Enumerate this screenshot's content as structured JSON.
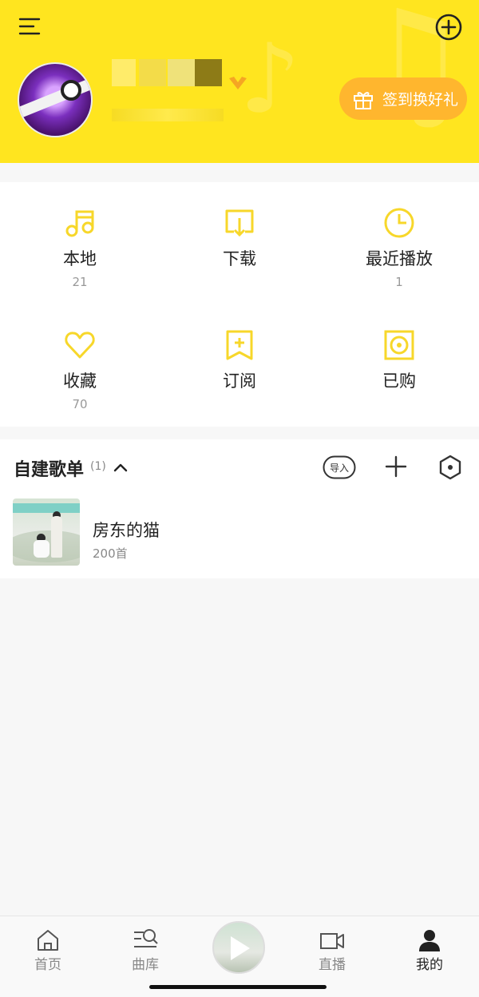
{
  "header": {
    "checkin_label": "签到换好礼",
    "vip_badge": "V"
  },
  "grid": [
    {
      "label": "本地",
      "count": "21",
      "icon": "music-note-icon"
    },
    {
      "label": "下载",
      "count": "",
      "icon": "download-icon"
    },
    {
      "label": "最近播放",
      "count": "1",
      "icon": "clock-icon"
    },
    {
      "label": "收藏",
      "count": "70",
      "icon": "heart-icon"
    },
    {
      "label": "订阅",
      "count": "",
      "icon": "bookmark-plus-icon"
    },
    {
      "label": "已购",
      "count": "",
      "icon": "disc-icon"
    }
  ],
  "playlists": {
    "title": "自建歌单",
    "count": "(1)",
    "import_label": "导入",
    "items": [
      {
        "name": "房东的猫",
        "songs": "200首"
      }
    ]
  },
  "tabbar": {
    "items": [
      {
        "label": "首页",
        "icon": "home-icon"
      },
      {
        "label": "曲库",
        "icon": "library-search-icon"
      },
      {
        "label": "",
        "icon": "play-icon"
      },
      {
        "label": "直播",
        "icon": "video-camera-icon"
      },
      {
        "label": "我的",
        "icon": "user-icon"
      }
    ]
  },
  "colors": {
    "brand_yellow": "#ffe51f",
    "accent_orange": "#ffb62e",
    "icon_yellow": "#f7d72a"
  }
}
